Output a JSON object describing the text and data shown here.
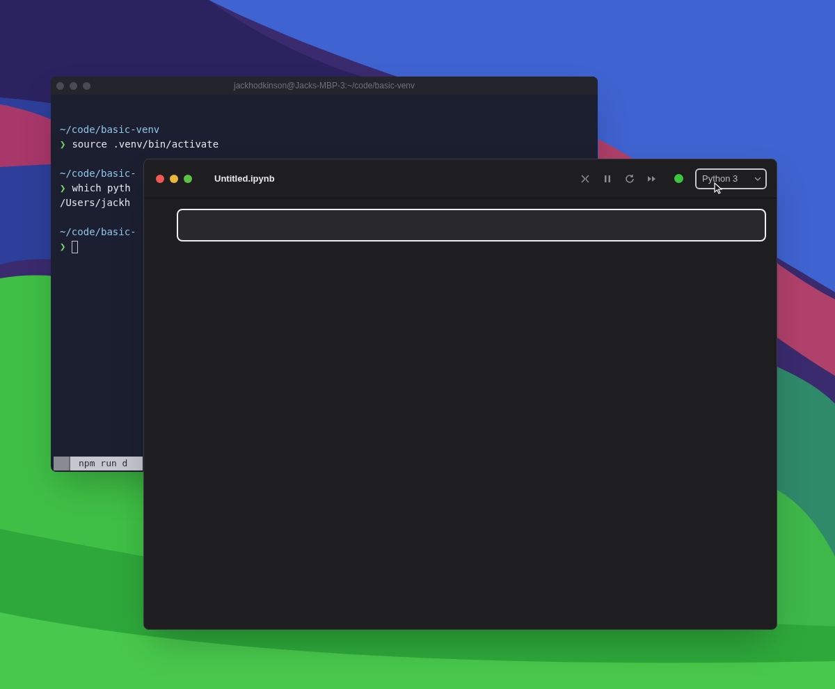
{
  "terminal": {
    "title": "jackhodkinson@Jacks-MBP-3:~/code/basic-venv",
    "blocks": [
      {
        "path": "~/code/basic-venv",
        "prompt": "❯",
        "command": "source .venv/bin/activate"
      },
      {
        "path": "~/code/basic-",
        "prompt": "❯",
        "command": "which pyth",
        "output": "/Users/jackh"
      },
      {
        "path": "~/code/basic-",
        "prompt": "❯",
        "cursor": true
      }
    ],
    "tab": "npm run d"
  },
  "notebook": {
    "title": "Untitled.ipynb",
    "kernel_connected": true,
    "kernel": "Python 3",
    "cells": [
      {
        "selected": true
      }
    ]
  }
}
